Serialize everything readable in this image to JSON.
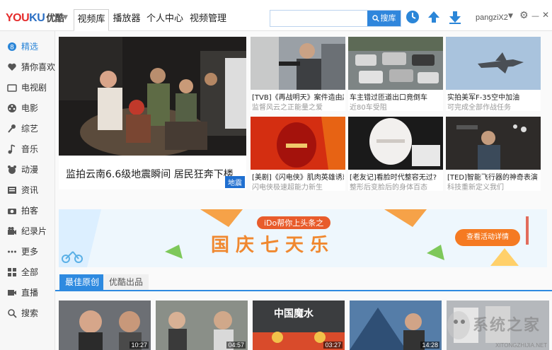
{
  "logo": {
    "you": "YOU",
    "ku": "KU",
    "cn": "优酷"
  },
  "nav": {
    "tabs": [
      "视频库",
      "播放器",
      "个人中心",
      "视频管理"
    ],
    "active": "视频库"
  },
  "search": {
    "placeholder": "",
    "button": "搜库"
  },
  "user": {
    "name": "pangziX2"
  },
  "window_controls": {
    "settings": "⚙",
    "minimize": "—",
    "close": "✕"
  },
  "sidebar": {
    "items": [
      {
        "label": "精选",
        "icon": "featured-icon"
      },
      {
        "label": "猜你喜欢",
        "icon": "heart-icon"
      },
      {
        "label": "电视剧",
        "icon": "tv-icon"
      },
      {
        "label": "电影",
        "icon": "film-icon"
      },
      {
        "label": "综艺",
        "icon": "microphone-icon"
      },
      {
        "label": "音乐",
        "icon": "music-icon"
      },
      {
        "label": "动漫",
        "icon": "bear-icon"
      },
      {
        "label": "资讯",
        "icon": "news-icon"
      },
      {
        "label": "拍客",
        "icon": "camera-icon"
      },
      {
        "label": "纪录片",
        "icon": "documentary-icon"
      },
      {
        "label": "更多",
        "icon": "more-icon"
      },
      {
        "label": "全部",
        "icon": "grid-icon"
      },
      {
        "label": "直播",
        "icon": "live-icon"
      },
      {
        "label": "搜索",
        "icon": "search-icon"
      }
    ]
  },
  "featured": {
    "title": "监拍云南6.6级地震瞬间 居民狂奔下楼",
    "tag": "地震"
  },
  "cards": [
    {
      "title": "[TVB]《再战明天》案件造由起",
      "sub": "监督风云之正能量之爱"
    },
    {
      "title": "车主错过匝道出口竟倒车",
      "sub": "近80车受阻"
    },
    {
      "title": "实拍美军F-35空中加油",
      "sub": "可完成全部作战任务"
    },
    {
      "title": "[美剧]《闪电侠》肌肉英雄诱惑",
      "sub": "闪电侠极速超能力新生"
    },
    {
      "title": "[老友记]看脸时代整容无过?",
      "sub": "整形后变脸后的身体百态"
    },
    {
      "title": "[TED]智能飞行器的神奇表演",
      "sub": "科技重新定义我们"
    }
  ],
  "banner": {
    "slogan": "iDo帮你上头条之",
    "main": "国庆七天乐",
    "button": "查看活动详情"
  },
  "bottom_tabs": [
    "最佳原创",
    "优酷出品"
  ],
  "videos": [
    {
      "duration": "10:27"
    },
    {
      "duration": "04:57"
    },
    {
      "duration": "03:27",
      "title": "中国魔水"
    },
    {
      "duration": "14:28"
    }
  ],
  "watermark": {
    "text": "系统之家",
    "sub": "XITONGZHIJIA.NET"
  }
}
